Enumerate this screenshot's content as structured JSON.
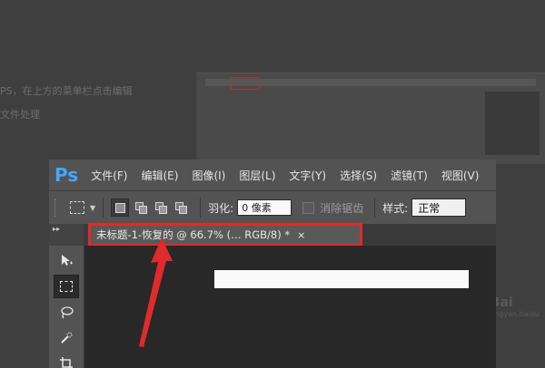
{
  "background": {
    "line1": "PS，在上方的菜单栏点击编辑",
    "line2": "文件处理"
  },
  "app": {
    "logo": "Ps"
  },
  "menubar": {
    "items": [
      "文件(F)",
      "编辑(E)",
      "图像(I)",
      "图层(L)",
      "文字(Y)",
      "选择(S)",
      "滤镜(T)",
      "视图(V)"
    ]
  },
  "options": {
    "feather_label": "羽化:",
    "feather_value": "0 像素",
    "antialias_label": "消除锯齿",
    "style_label": "样式:",
    "style_value": "正常"
  },
  "document_tab": {
    "title": "未标题-1-恢复的 @ 66.7% (… RGB/8) *",
    "close": "×"
  },
  "watermark": {
    "main": "Bai",
    "sub": "jingyan.baidu"
  },
  "colors": {
    "logo_blue": "#41a8ff",
    "highlight_red": "#e12a2a",
    "ps_gray": "#535353"
  }
}
